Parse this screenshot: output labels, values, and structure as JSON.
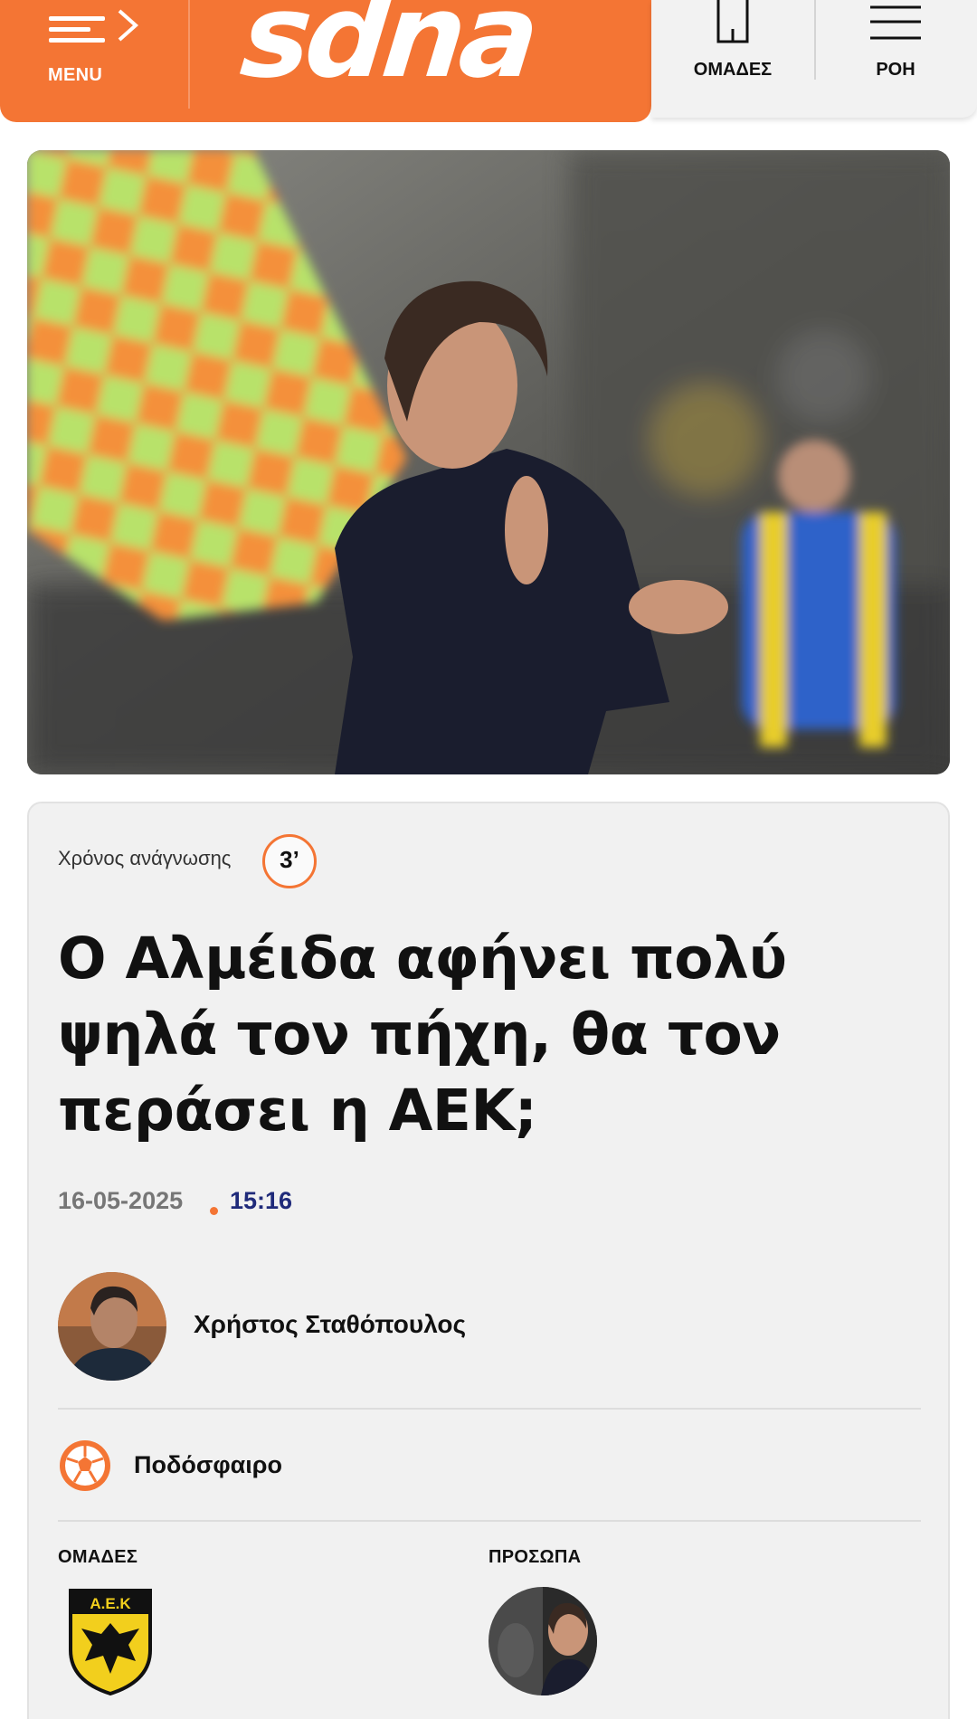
{
  "header": {
    "menu_label": "MENU",
    "logo_text": "sdna",
    "nav": [
      {
        "label": "ΟΜΑΔΕΣ",
        "icon": "jersey-icon"
      },
      {
        "label": "ΡΟΗ",
        "icon": "feed-icon"
      }
    ]
  },
  "article": {
    "read_time_label": "Χρόνος ανάγνωσης",
    "read_time_value": "3’",
    "title": "Ο Αλμέιδα αφήνει πολύ ψηλά τον πήχη, θα τον περάσει η ΑΕΚ;",
    "date": "16-05-2025",
    "time": "15:16",
    "author": "Χρήστος Σταθόπουλος",
    "category": "Ποδόσφαιρο",
    "teams_heading": "ΟΜΑΔΕΣ",
    "people_heading": "ΠΡΟΣΩΠΑ",
    "team_badge_text": "Α.Ε.Κ"
  },
  "colors": {
    "brand_orange": "#f47534",
    "time_blue": "#1f2a7a",
    "card_bg": "#f1f1f1"
  }
}
